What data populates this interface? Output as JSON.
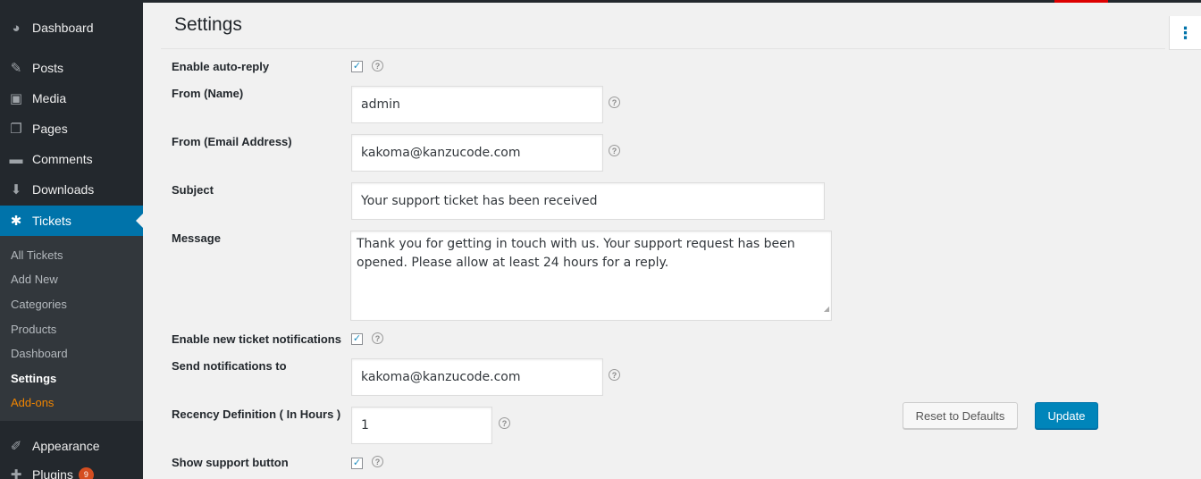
{
  "sidebar": {
    "menu": [
      {
        "label": "Dashboard",
        "icon": "dashboard-icon"
      },
      {
        "label": "Posts",
        "icon": "pin-icon"
      },
      {
        "label": "Media",
        "icon": "media-icon"
      },
      {
        "label": "Pages",
        "icon": "pages-icon"
      },
      {
        "label": "Comments",
        "icon": "comment-icon"
      },
      {
        "label": "Downloads",
        "icon": "download-icon"
      },
      {
        "label": "Tickets",
        "icon": "groups-icon"
      },
      {
        "label": "Appearance",
        "icon": "paintbrush-icon"
      },
      {
        "label": "Plugins",
        "icon": "plugin-icon",
        "badge": "9"
      }
    ],
    "submenu": [
      "All Tickets",
      "Add New",
      "Categories",
      "Products",
      "Dashboard",
      "Settings",
      "Add-ons"
    ]
  },
  "page": {
    "title": "Settings"
  },
  "form": {
    "auto_reply_label": "Enable auto-reply",
    "from_name_label": "From (Name)",
    "from_name_value": "admin",
    "from_email_label": "From (Email Address)",
    "from_email_value": "kakoma@kanzucode.com",
    "subject_label": "Subject",
    "subject_value": "Your support ticket has been received",
    "message_label": "Message",
    "message_value": "Thank you for getting in touch with us. Your support request has been opened. Please allow at least 24 hours for a reply.",
    "notifications_label": "Enable new ticket notifications",
    "send_to_label": "Send notifications to",
    "send_to_value": "kakoma@kanzucode.com",
    "recency_label": "Recency Definition ( In Hours )",
    "recency_value": "1",
    "support_button_label": "Show support button"
  },
  "buttons": {
    "reset": "Reset to Defaults",
    "update": "Update"
  },
  "colors": {
    "accent": "#0073aa",
    "primary_button": "#0085ba",
    "sidebar": "#23282d",
    "addons": "#f18500"
  }
}
